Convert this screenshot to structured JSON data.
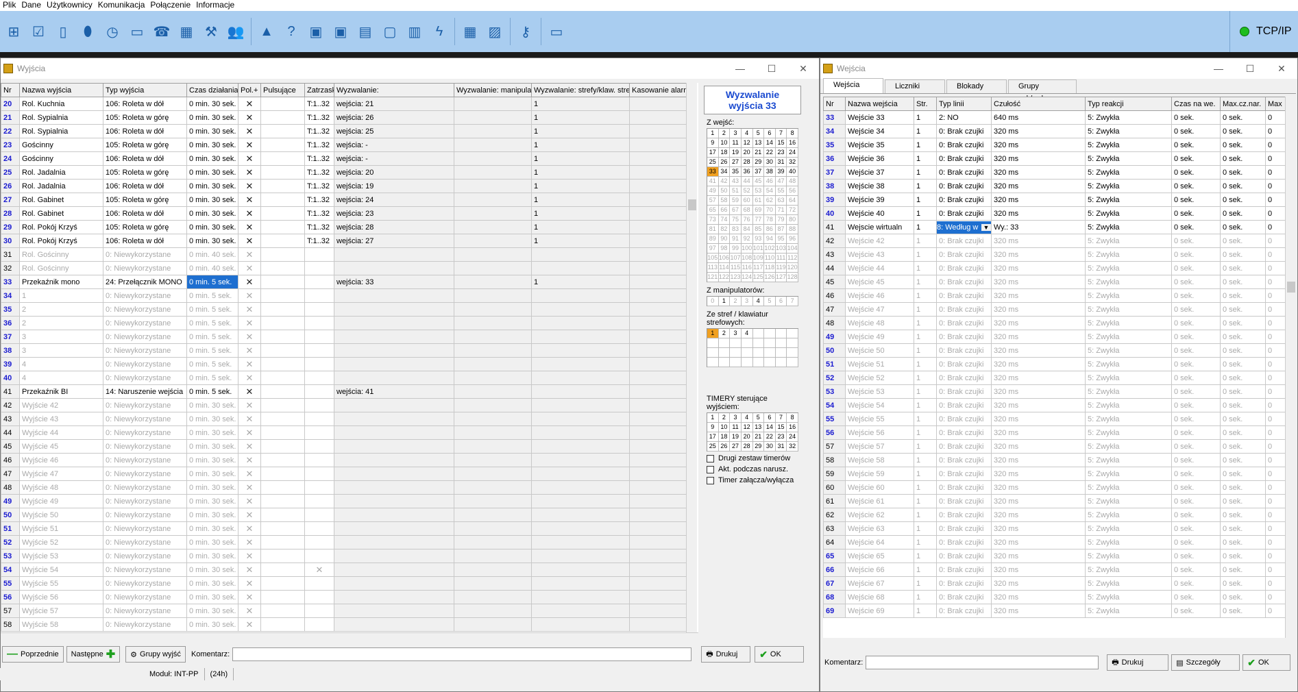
{
  "menu": [
    "Plik",
    "Dane",
    "Użytkownicy",
    "Komunikacja",
    "Połączenie",
    "Informacje"
  ],
  "toolbar_icons": [
    "structure-icon",
    "checklist-icon",
    "module-icon",
    "alarm-icon",
    "clock-icon",
    "monitor-icon",
    "phone-icon",
    "calendar-icon",
    "tools-icon",
    "users-icon",
    "triangle-icon",
    "help-icon",
    "screen-green-icon",
    "screen-red-icon",
    "document-icon",
    "device-icon",
    "panel-icon",
    "lightning-icon",
    "calculator-icon",
    "picture-icon",
    "key-icon",
    "computer-icon"
  ],
  "connection": {
    "label": "TCP/IP",
    "color": "#1ebd1e"
  },
  "left": {
    "title": "Wyjścia",
    "columns": [
      "Nr",
      "Nazwa wyjścia",
      "Typ wyjścia",
      "Czas działania",
      "Pol.+",
      "Pulsujące",
      "Zatrzask",
      "Wyzwalanie:",
      "Wyzwalanie: manipulat",
      "Wyzwalanie: strefy/klaw. stre",
      "Kasowanie alarmu"
    ],
    "rows": [
      [
        "20",
        "Rol. Kuchnia",
        "106: Roleta w dół",
        "0  min. 30 sek.",
        "✕",
        "",
        "T:1..32",
        "wejścia: 21",
        "",
        "1",
        ""
      ],
      [
        "21",
        "Rol. Sypialnia",
        "105: Roleta w górę",
        "0  min. 30 sek.",
        "✕",
        "",
        "T:1..32",
        "wejścia: 26",
        "",
        "1",
        ""
      ],
      [
        "22",
        "Rol. Sypialnia",
        "106: Roleta w dół",
        "0  min. 30 sek.",
        "✕",
        "",
        "T:1..32",
        "wejścia: 25",
        "",
        "1",
        ""
      ],
      [
        "23",
        "Gościnny",
        "105: Roleta w górę",
        "0  min. 30 sek.",
        "✕",
        "",
        "T:1..32",
        "wejścia: -",
        "",
        "1",
        ""
      ],
      [
        "24",
        "Gościnny",
        "106: Roleta w dół",
        "0  min. 30 sek.",
        "✕",
        "",
        "T:1..32",
        "wejścia: -",
        "",
        "1",
        ""
      ],
      [
        "25",
        "Rol. Jadalnia",
        "105: Roleta w górę",
        "0  min. 30 sek.",
        "✕",
        "",
        "T:1..32",
        "wejścia: 20",
        "",
        "1",
        ""
      ],
      [
        "26",
        "Rol. Jadalnia",
        "106: Roleta w dół",
        "0  min. 30 sek.",
        "✕",
        "",
        "T:1..32",
        "wejścia: 19",
        "",
        "1",
        ""
      ],
      [
        "27",
        "Rol. Gabinet",
        "105: Roleta w górę",
        "0  min. 30 sek.",
        "✕",
        "",
        "T:1..32",
        "wejścia: 24",
        "",
        "1",
        ""
      ],
      [
        "28",
        "Rol. Gabinet",
        "106: Roleta w dół",
        "0  min. 30 sek.",
        "✕",
        "",
        "T:1..32",
        "wejścia: 23",
        "",
        "1",
        ""
      ],
      [
        "29",
        "Rol. Pokój Krzyś",
        "105: Roleta w górę",
        "0  min. 30 sek.",
        "✕",
        "",
        "T:1..32",
        "wejścia: 28",
        "",
        "1",
        ""
      ],
      [
        "30",
        "Rol. Pokój Krzyś",
        "106: Roleta w dół",
        "0  min. 30 sek.",
        "✕",
        "",
        "T:1..32",
        "wejścia: 27",
        "",
        "1",
        ""
      ],
      [
        "31",
        "Rol. Gościnny",
        "0: Niewykorzystane",
        "0  min. 40 sek.",
        "✕",
        "",
        "",
        "",
        "",
        "",
        ""
      ],
      [
        "32",
        "Rol. Gościnny",
        "0: Niewykorzystane",
        "0  min. 40 sek.",
        "✕",
        "",
        "",
        "",
        "",
        "",
        ""
      ],
      [
        "33",
        "Przekaźnik mono",
        "24: Przełącznik MONO",
        "0  min. 5  sek.",
        "✕",
        "",
        "",
        "wejścia: 33",
        "",
        "1",
        ""
      ],
      [
        "34",
        "1",
        "0: Niewykorzystane",
        "0  min. 5  sek.",
        "✕",
        "",
        "",
        "",
        "",
        "",
        ""
      ],
      [
        "35",
        "2",
        "0: Niewykorzystane",
        "0  min. 5  sek.",
        "✕",
        "",
        "",
        "",
        "",
        "",
        ""
      ],
      [
        "36",
        "2",
        "0: Niewykorzystane",
        "0  min. 5  sek.",
        "✕",
        "",
        "",
        "",
        "",
        "",
        ""
      ],
      [
        "37",
        "3",
        "0: Niewykorzystane",
        "0  min. 5  sek.",
        "✕",
        "",
        "",
        "",
        "",
        "",
        ""
      ],
      [
        "38",
        "3",
        "0: Niewykorzystane",
        "0  min. 5  sek.",
        "✕",
        "",
        "",
        "",
        "",
        "",
        ""
      ],
      [
        "39",
        "4",
        "0: Niewykorzystane",
        "0  min. 5  sek.",
        "✕",
        "",
        "",
        "",
        "",
        "",
        ""
      ],
      [
        "40",
        "4",
        "0: Niewykorzystane",
        "0  min. 5  sek.",
        "✕",
        "",
        "",
        "",
        "",
        "",
        ""
      ],
      [
        "41",
        "Przekaźnik BI",
        "14: Naruszenie wejścia",
        "0  min. 5  sek.",
        "✕",
        "",
        "",
        "wejścia: 41",
        "",
        "",
        ""
      ],
      [
        "42",
        "Wyjście  42",
        "0: Niewykorzystane",
        "0  min. 30 sek.",
        "✕",
        "",
        "",
        "",
        "",
        "",
        ""
      ],
      [
        "43",
        "Wyjście  43",
        "0: Niewykorzystane",
        "0  min. 30 sek.",
        "✕",
        "",
        "",
        "",
        "",
        "",
        ""
      ],
      [
        "44",
        "Wyjście  44",
        "0: Niewykorzystane",
        "0  min. 30 sek.",
        "✕",
        "",
        "",
        "",
        "",
        "",
        ""
      ],
      [
        "45",
        "Wyjście  45",
        "0: Niewykorzystane",
        "0  min. 30 sek.",
        "✕",
        "",
        "",
        "",
        "",
        "",
        ""
      ],
      [
        "46",
        "Wyjście  46",
        "0: Niewykorzystane",
        "0  min. 30 sek.",
        "✕",
        "",
        "",
        "",
        "",
        "",
        ""
      ],
      [
        "47",
        "Wyjście  47",
        "0: Niewykorzystane",
        "0  min. 30 sek.",
        "✕",
        "",
        "",
        "",
        "",
        "",
        ""
      ],
      [
        "48",
        "Wyjście  48",
        "0: Niewykorzystane",
        "0  min. 30 sek.",
        "✕",
        "",
        "",
        "",
        "",
        "",
        ""
      ],
      [
        "49",
        "Wyjście  49",
        "0: Niewykorzystane",
        "0  min. 30 sek.",
        "✕",
        "",
        "",
        "",
        "",
        "",
        ""
      ],
      [
        "50",
        "Wyjście  50",
        "0: Niewykorzystane",
        "0  min. 30 sek.",
        "✕",
        "",
        "",
        "",
        "",
        "",
        ""
      ],
      [
        "51",
        "Wyjście  51",
        "0: Niewykorzystane",
        "0  min. 30 sek.",
        "✕",
        "",
        "",
        "",
        "",
        "",
        ""
      ],
      [
        "52",
        "Wyjście  52",
        "0: Niewykorzystane",
        "0  min. 30 sek.",
        "✕",
        "",
        "",
        "",
        "",
        "",
        ""
      ],
      [
        "53",
        "Wyjście  53",
        "0: Niewykorzystane",
        "0  min. 30 sek.",
        "✕",
        "",
        "",
        "",
        "",
        "",
        ""
      ],
      [
        "54",
        "Wyjście  54",
        "0: Niewykorzystane",
        "0  min. 30 sek.",
        "✕",
        "",
        "✕",
        "",
        "",
        "",
        ""
      ],
      [
        "55",
        "Wyjście  55",
        "0: Niewykorzystane",
        "0  min. 30 sek.",
        "✕",
        "",
        "",
        "",
        "",
        "",
        ""
      ],
      [
        "56",
        "Wyjście  56",
        "0: Niewykorzystane",
        "0  min. 30 sek.",
        "✕",
        "",
        "",
        "",
        "",
        "",
        ""
      ],
      [
        "57",
        "Wyjście  57",
        "0: Niewykorzystane",
        "0  min. 30 sek.",
        "✕",
        "",
        "",
        "",
        "",
        "",
        ""
      ],
      [
        "58",
        "Wyjście  58",
        "0: Niewykorzystane",
        "0  min. 30 sek.",
        "✕",
        "",
        "",
        "",
        "",
        "",
        ""
      ]
    ],
    "active_rows": [
      "20",
      "21",
      "22",
      "23",
      "24",
      "25",
      "26",
      "27",
      "28",
      "29",
      "30",
      "33",
      "41"
    ],
    "black_nr": [
      "31",
      "32",
      "41",
      "42",
      "43",
      "44",
      "45",
      "46",
      "47",
      "48",
      "57",
      "58"
    ],
    "selected_cell": {
      "row": "33",
      "col": 3
    },
    "panel": {
      "title": "Wyzwalanie wyjścia 33",
      "z_wejsc": "Z wejść:",
      "z_manip": "Z manipulatorów:",
      "manip_values": [
        "0",
        "1",
        "2",
        "3",
        "4",
        "5",
        "6",
        "7"
      ],
      "ze_stref": "Ze stref / klawiatur strefowych:",
      "strefy_values": [
        "1",
        "2",
        "3",
        "4"
      ],
      "timery_label": "TIMERY sterujące wyjściem:",
      "checks": [
        "Drugi zestaw timerów",
        "Akt. podczas narusz.",
        "Timer załącza/wyłącza"
      ],
      "highlight_input": "33",
      "highlight_zone": "1"
    },
    "buttons": {
      "prev": "Poprzednie",
      "next": "Następne",
      "groups": "Grupy wyjść",
      "comment_label": "Komentarz:",
      "comment_value": "",
      "print": "Drukuj",
      "ok": "OK"
    },
    "status": {
      "module": "Moduł: INT-PP",
      "hours": "(24h)"
    }
  },
  "right": {
    "title": "Wejścia",
    "tabs": [
      "Wejścia",
      "Liczniki",
      "Blokady",
      "Grupy zał./wył."
    ],
    "columns": [
      "Nr",
      "Nazwa wejścia",
      "Str.",
      "Typ linii",
      "Czułość",
      "Typ reakcji",
      "Czas na we.",
      "Max.cz.nar.",
      "Max"
    ],
    "rows": [
      [
        "33",
        "Wejście  33",
        "1",
        "2: NO",
        "640 ms",
        "5: Zwykła",
        "0 sek.",
        "0 sek.",
        "0"
      ],
      [
        "34",
        "Wejście  34",
        "1",
        "0: Brak czujki",
        "320 ms",
        "5: Zwykła",
        "0 sek.",
        "0 sek.",
        "0"
      ],
      [
        "35",
        "Wejście  35",
        "1",
        "0: Brak czujki",
        "320 ms",
        "5: Zwykła",
        "0 sek.",
        "0 sek.",
        "0"
      ],
      [
        "36",
        "Wejście  36",
        "1",
        "0: Brak czujki",
        "320 ms",
        "5: Zwykła",
        "0 sek.",
        "0 sek.",
        "0"
      ],
      [
        "37",
        "Wejście  37",
        "1",
        "0: Brak czujki",
        "320 ms",
        "5: Zwykła",
        "0 sek.",
        "0 sek.",
        "0"
      ],
      [
        "38",
        "Wejście  38",
        "1",
        "0: Brak czujki",
        "320 ms",
        "5: Zwykła",
        "0 sek.",
        "0 sek.",
        "0"
      ],
      [
        "39",
        "Wejście  39",
        "1",
        "0: Brak czujki",
        "320 ms",
        "5: Zwykła",
        "0 sek.",
        "0 sek.",
        "0"
      ],
      [
        "40",
        "Wejście  40",
        "1",
        "0: Brak czujki",
        "320 ms",
        "5: Zwykła",
        "0 sek.",
        "0 sek.",
        "0"
      ],
      [
        "41",
        "Wejscie wirtualn",
        "1",
        "8: Według w",
        "Wy.: 33",
        "5: Zwykła",
        "0 sek.",
        "0 sek.",
        "0"
      ],
      [
        "42",
        "Wejście  42",
        "1",
        "0: Brak czujki",
        "320 ms",
        "5: Zwykła",
        "0 sek.",
        "0 sek.",
        "0"
      ],
      [
        "43",
        "Wejście  43",
        "1",
        "0: Brak czujki",
        "320 ms",
        "5: Zwykła",
        "0 sek.",
        "0 sek.",
        "0"
      ],
      [
        "44",
        "Wejście  44",
        "1",
        "0: Brak czujki",
        "320 ms",
        "5: Zwykła",
        "0 sek.",
        "0 sek.",
        "0"
      ],
      [
        "45",
        "Wejście  45",
        "1",
        "0: Brak czujki",
        "320 ms",
        "5: Zwykła",
        "0 sek.",
        "0 sek.",
        "0"
      ],
      [
        "46",
        "Wejście  46",
        "1",
        "0: Brak czujki",
        "320 ms",
        "5: Zwykła",
        "0 sek.",
        "0 sek.",
        "0"
      ],
      [
        "47",
        "Wejście  47",
        "1",
        "0: Brak czujki",
        "320 ms",
        "5: Zwykła",
        "0 sek.",
        "0 sek.",
        "0"
      ],
      [
        "48",
        "Wejście  48",
        "1",
        "0: Brak czujki",
        "320 ms",
        "5: Zwykła",
        "0 sek.",
        "0 sek.",
        "0"
      ],
      [
        "49",
        "Wejście  49",
        "1",
        "0: Brak czujki",
        "320 ms",
        "5: Zwykła",
        "0 sek.",
        "0 sek.",
        "0"
      ],
      [
        "50",
        "Wejście  50",
        "1",
        "0: Brak czujki",
        "320 ms",
        "5: Zwykła",
        "0 sek.",
        "0 sek.",
        "0"
      ],
      [
        "51",
        "Wejście  51",
        "1",
        "0: Brak czujki",
        "320 ms",
        "5: Zwykła",
        "0 sek.",
        "0 sek.",
        "0"
      ],
      [
        "52",
        "Wejście  52",
        "1",
        "0: Brak czujki",
        "320 ms",
        "5: Zwykła",
        "0 sek.",
        "0 sek.",
        "0"
      ],
      [
        "53",
        "Wejście  53",
        "1",
        "0: Brak czujki",
        "320 ms",
        "5: Zwykła",
        "0 sek.",
        "0 sek.",
        "0"
      ],
      [
        "54",
        "Wejście  54",
        "1",
        "0: Brak czujki",
        "320 ms",
        "5: Zwykła",
        "0 sek.",
        "0 sek.",
        "0"
      ],
      [
        "55",
        "Wejście  55",
        "1",
        "0: Brak czujki",
        "320 ms",
        "5: Zwykła",
        "0 sek.",
        "0 sek.",
        "0"
      ],
      [
        "56",
        "Wejście  56",
        "1",
        "0: Brak czujki",
        "320 ms",
        "5: Zwykła",
        "0 sek.",
        "0 sek.",
        "0"
      ],
      [
        "57",
        "Wejście  57",
        "1",
        "0: Brak czujki",
        "320 ms",
        "5: Zwykła",
        "0 sek.",
        "0 sek.",
        "0"
      ],
      [
        "58",
        "Wejście  58",
        "1",
        "0: Brak czujki",
        "320 ms",
        "5: Zwykła",
        "0 sek.",
        "0 sek.",
        "0"
      ],
      [
        "59",
        "Wejście  59",
        "1",
        "0: Brak czujki",
        "320 ms",
        "5: Zwykła",
        "0 sek.",
        "0 sek.",
        "0"
      ],
      [
        "60",
        "Wejście  60",
        "1",
        "0: Brak czujki",
        "320 ms",
        "5: Zwykła",
        "0 sek.",
        "0 sek.",
        "0"
      ],
      [
        "61",
        "Wejście  61",
        "1",
        "0: Brak czujki",
        "320 ms",
        "5: Zwykła",
        "0 sek.",
        "0 sek.",
        "0"
      ],
      [
        "62",
        "Wejście  62",
        "1",
        "0: Brak czujki",
        "320 ms",
        "5: Zwykła",
        "0 sek.",
        "0 sek.",
        "0"
      ],
      [
        "63",
        "Wejście  63",
        "1",
        "0: Brak czujki",
        "320 ms",
        "5: Zwykła",
        "0 sek.",
        "0 sek.",
        "0"
      ],
      [
        "64",
        "Wejście  64",
        "1",
        "0: Brak czujki",
        "320 ms",
        "5: Zwykła",
        "0 sek.",
        "0 sek.",
        "0"
      ],
      [
        "65",
        "Wejście  65",
        "1",
        "0: Brak czujki",
        "320 ms",
        "5: Zwykła",
        "0 sek.",
        "0 sek.",
        "0"
      ],
      [
        "66",
        "Wejście  66",
        "1",
        "0: Brak czujki",
        "320 ms",
        "5: Zwykła",
        "0 sek.",
        "0 sek.",
        "0"
      ],
      [
        "67",
        "Wejście  67",
        "1",
        "0: Brak czujki",
        "320 ms",
        "5: Zwykła",
        "0 sek.",
        "0 sek.",
        "0"
      ],
      [
        "68",
        "Wejście  68",
        "1",
        "0: Brak czujki",
        "320 ms",
        "5: Zwykła",
        "0 sek.",
        "0 sek.",
        "0"
      ],
      [
        "69",
        "Wejście  69",
        "1",
        "0: Brak czujki",
        "320 ms",
        "5: Zwykła",
        "0 sek.",
        "0 sek.",
        "0"
      ]
    ],
    "active_rows": [
      "33",
      "34",
      "35",
      "36",
      "37",
      "38",
      "39",
      "40",
      "41"
    ],
    "black_nr": [
      "41",
      "42",
      "43",
      "44",
      "45",
      "46",
      "47",
      "48",
      "57",
      "58",
      "59",
      "60",
      "61",
      "62",
      "63",
      "64"
    ],
    "buttons": {
      "comment_label": "Komentarz:",
      "comment_value": "",
      "print": "Drukuj",
      "details": "Szczegóły",
      "ok": "OK"
    }
  }
}
